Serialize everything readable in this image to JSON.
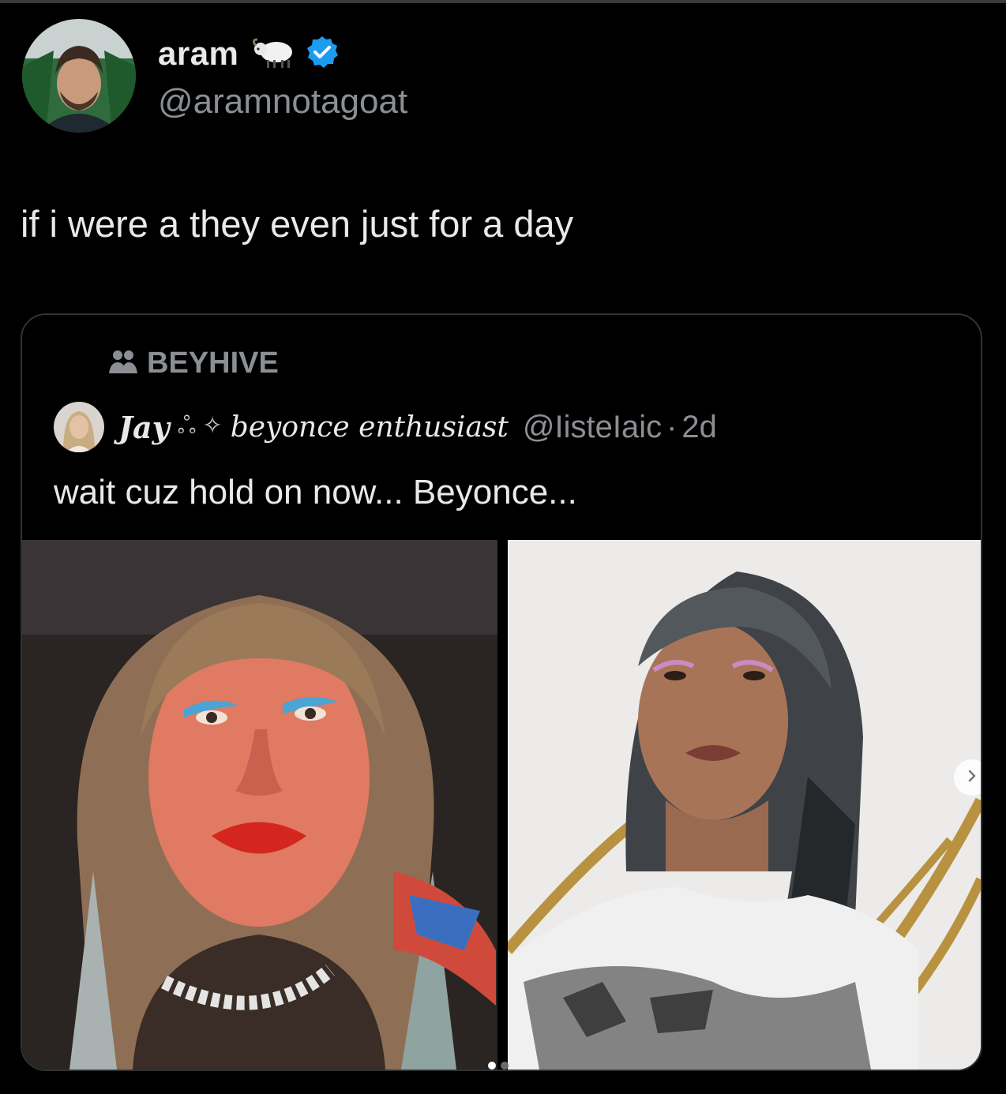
{
  "tweet": {
    "author": {
      "display_name": "aram",
      "badge_emoji_icon": "sheep-icon",
      "verified": true,
      "handle": "@aramnotagoat"
    },
    "text": "if i were a they even just for a day"
  },
  "quoted_tweet": {
    "community_label": "BEYHIVE",
    "author": {
      "name": "Jay",
      "symbols": "ஃ ✧",
      "tagline": "beyonce enthusiast",
      "handle": "@IisteIaic",
      "separator": "·",
      "time": "2d"
    },
    "text": "wait cuz hold on now... Beyonce...",
    "media": {
      "count": 2,
      "active_index": 0
    }
  },
  "colors": {
    "background": "#000000",
    "text_primary": "#e7e9ea",
    "text_secondary": "#8b8f93",
    "verified_blue": "#1d9bf0",
    "border": "#2f3336"
  }
}
